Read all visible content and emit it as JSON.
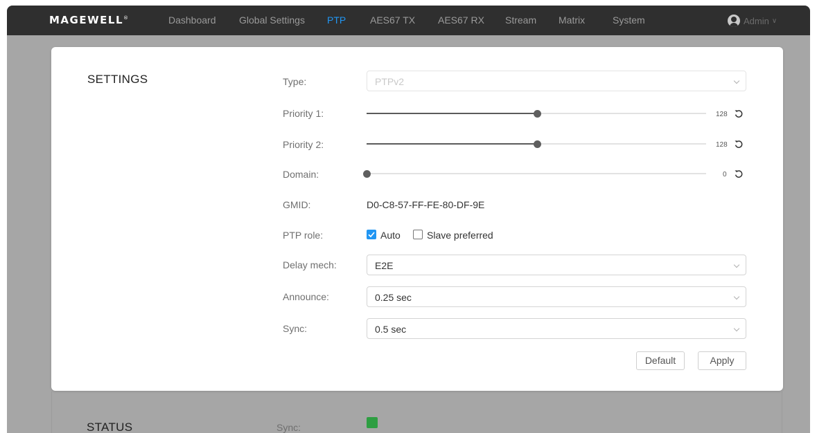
{
  "header": {
    "logo": "MAGEWELL",
    "logo_mark": "®",
    "nav": [
      {
        "label": "Dashboard"
      },
      {
        "label": "Global Settings"
      },
      {
        "label": "PTP"
      },
      {
        "label": "AES67 TX"
      },
      {
        "label": "AES67 RX"
      },
      {
        "label": "Stream"
      },
      {
        "label": "Matrix"
      },
      {
        "label": "System"
      }
    ],
    "active_nav": "PTP",
    "user": "Admin"
  },
  "settings": {
    "title": "SETTINGS",
    "type": {
      "label": "Type:",
      "value": "PTPv2"
    },
    "priority1": {
      "label": "Priority 1:",
      "value": "128",
      "min": 0,
      "max": 255,
      "level": 128
    },
    "priority2": {
      "label": "Priority 2:",
      "value": "128",
      "min": 0,
      "max": 255,
      "level": 128
    },
    "domain": {
      "label": "Domain:",
      "value": "0",
      "min": 0,
      "max": 127,
      "level": 0
    },
    "gmid": {
      "label": "GMID:",
      "value": "D0-C8-57-FF-FE-80-DF-9E"
    },
    "ptp_role": {
      "label": "PTP role:",
      "options": [
        {
          "label": "Auto",
          "checked": true
        },
        {
          "label": "Slave preferred",
          "checked": false
        }
      ]
    },
    "delay_mech": {
      "label": "Delay mech:",
      "value": "E2E"
    },
    "announce": {
      "label": "Announce:",
      "value": "0.25 sec"
    },
    "sync": {
      "label": "Sync:",
      "value": "0.5 sec"
    },
    "buttons": {
      "default": "Default",
      "apply": "Apply"
    }
  },
  "status": {
    "title": "STATUS",
    "sync": {
      "label": "Sync:",
      "state": "locked",
      "color": "#2e9e42"
    }
  },
  "colors": {
    "accent": "#2196f3",
    "topbar": "#2f2f2f",
    "overlay": "#a6a6a6"
  }
}
